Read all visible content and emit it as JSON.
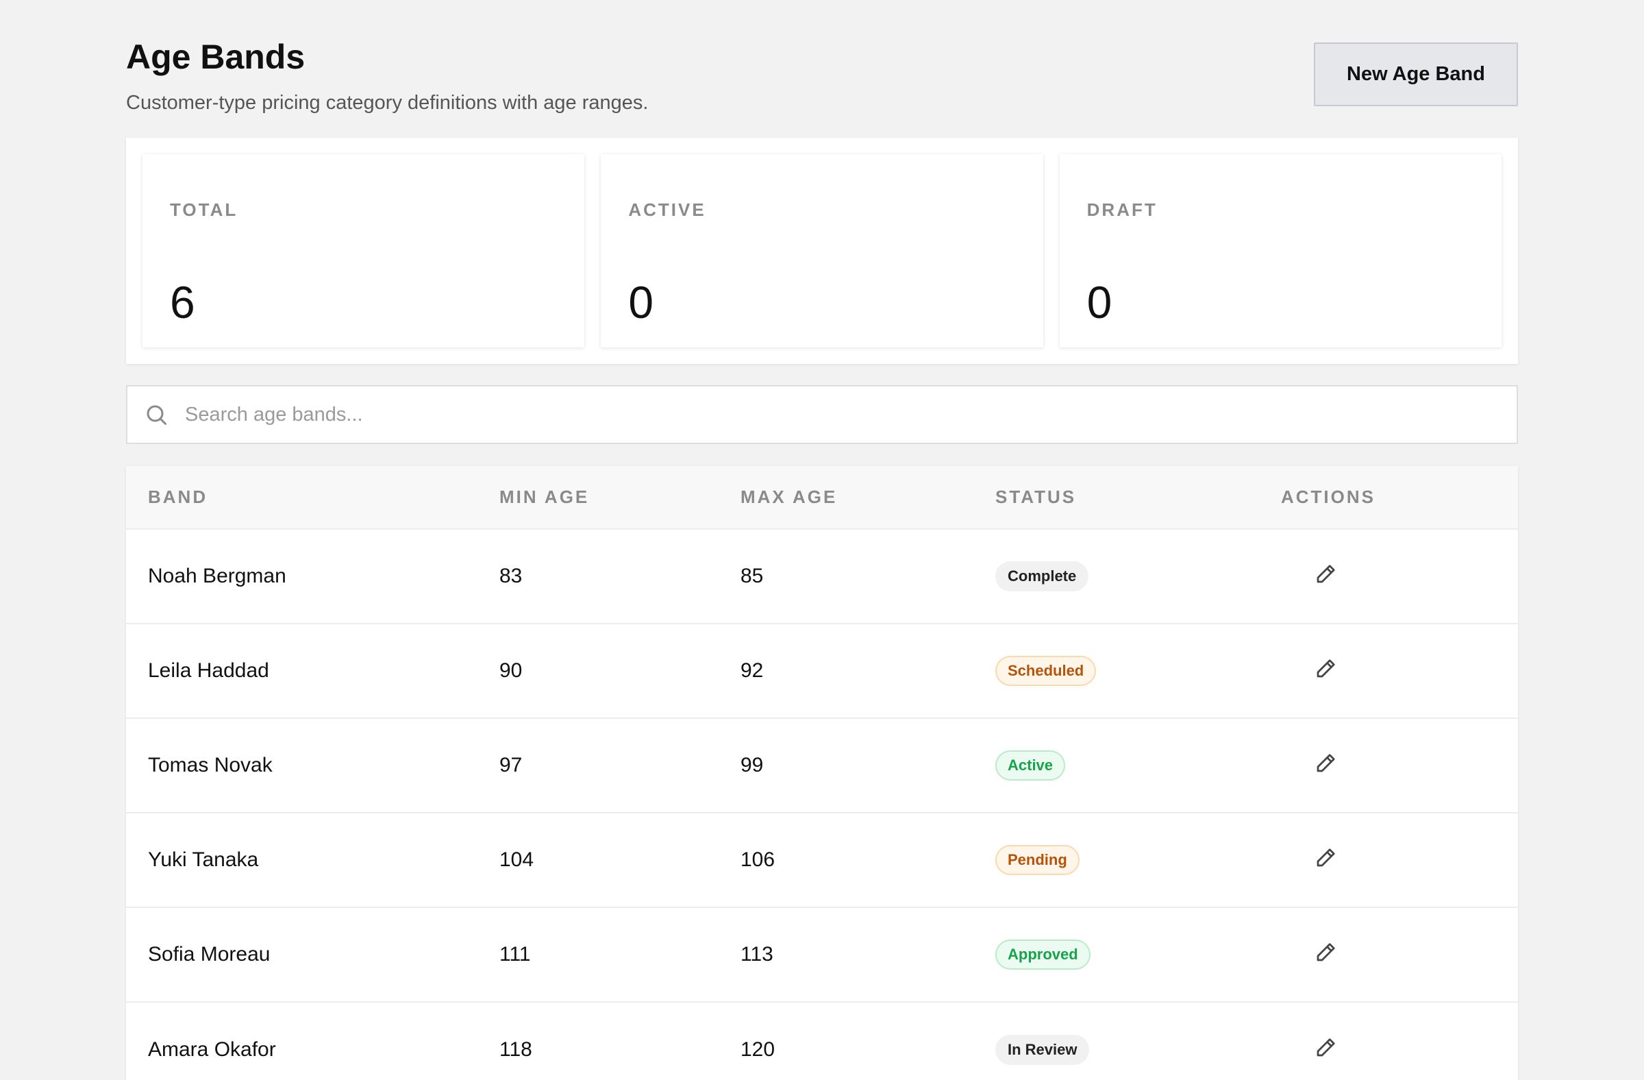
{
  "header": {
    "title": "Age Bands",
    "subtitle": "Customer-type pricing category definitions with age ranges.",
    "new_button_label": "New Age Band"
  },
  "stats": [
    {
      "label": "TOTAL",
      "value": "6"
    },
    {
      "label": "ACTIVE",
      "value": "0"
    },
    {
      "label": "DRAFT",
      "value": "0"
    }
  ],
  "search": {
    "placeholder": "Search age bands...",
    "value": "",
    "icon": "search-icon"
  },
  "table": {
    "columns": {
      "band": "BAND",
      "min_age": "MIN AGE",
      "max_age": "MAX AGE",
      "status": "STATUS",
      "actions": "ACTIONS"
    },
    "rows": [
      {
        "band": "Noah Bergman",
        "min_age": "83",
        "max_age": "85",
        "status": "Complete",
        "tone": "neutral"
      },
      {
        "band": "Leila Haddad",
        "min_age": "90",
        "max_age": "92",
        "status": "Scheduled",
        "tone": "orange"
      },
      {
        "band": "Tomas Novak",
        "min_age": "97",
        "max_age": "99",
        "status": "Active",
        "tone": "green"
      },
      {
        "band": "Yuki Tanaka",
        "min_age": "104",
        "max_age": "106",
        "status": "Pending",
        "tone": "orange"
      },
      {
        "band": "Sofia Moreau",
        "min_age": "111",
        "max_age": "113",
        "status": "Approved",
        "tone": "green"
      },
      {
        "band": "Amara Okafor",
        "min_age": "118",
        "max_age": "120",
        "status": "In Review",
        "tone": "neutral"
      }
    ],
    "action_icon": "pencil-icon"
  },
  "colors": {
    "background": "#f2f2f2",
    "surface": "#ffffff",
    "button_bg": "#e5e7eb",
    "status_orange": "#b45309",
    "status_green": "#16a34a"
  }
}
